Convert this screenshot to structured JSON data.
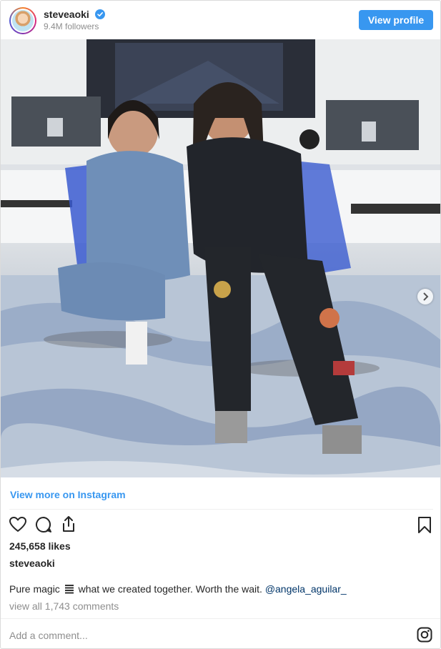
{
  "header": {
    "username": "steveaoki",
    "followers": "9.4M followers",
    "view_profile_label": "View profile"
  },
  "post": {
    "carousel_dots": 9,
    "active_dot": 0
  },
  "footer": {
    "view_more_label": "View more on Instagram",
    "likes": "245,658 likes",
    "owner": "steveaoki",
    "caption_before": "Pure magic ",
    "caption_after": " what we created together. Worth the wait. ",
    "caption_mention": "@angela_aguilar_",
    "comments_link": "view all 1,743 comments",
    "add_comment_placeholder": "Add a comment..."
  },
  "colors": {
    "accent": "#3897f0",
    "text": "#262626",
    "muted": "#8e8e8e",
    "mention": "#003569"
  },
  "icons": [
    "verified-badge-icon",
    "heart-icon",
    "comment-icon",
    "share-icon",
    "bookmark-icon",
    "instagram-icon",
    "chevron-right-icon"
  ]
}
